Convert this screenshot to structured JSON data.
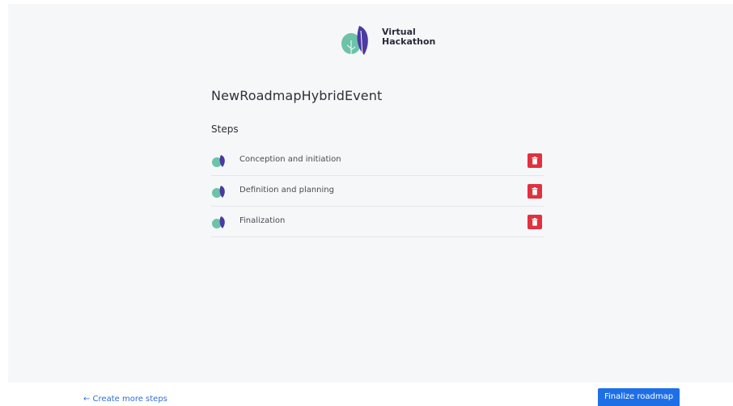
{
  "brand": {
    "line1": "Virtual",
    "line2": "Hackathon",
    "logo_icon": "twin-leaves-logo-icon",
    "colors": {
      "teal": "#6cc3a8",
      "purple": "#4b3aa0"
    }
  },
  "roadmap": {
    "title": "NewRoadmapHybridEvent",
    "steps_heading": "Steps",
    "steps": [
      {
        "label": "Conception and initiation",
        "icon": "step-leaves-icon",
        "delete_icon": "trash-icon"
      },
      {
        "label": "Definition and planning",
        "icon": "step-leaves-icon",
        "delete_icon": "trash-icon"
      },
      {
        "label": "Finalization",
        "icon": "step-leaves-icon",
        "delete_icon": "trash-icon"
      }
    ]
  },
  "footer": {
    "create_more_label": "← Create more steps",
    "finalize_label": "Finalize roadmap"
  },
  "colors": {
    "delete": "#e0313f",
    "primary": "#1d6fe8",
    "link": "#2f6fd6",
    "panel_bg": "#f6f7f9"
  }
}
